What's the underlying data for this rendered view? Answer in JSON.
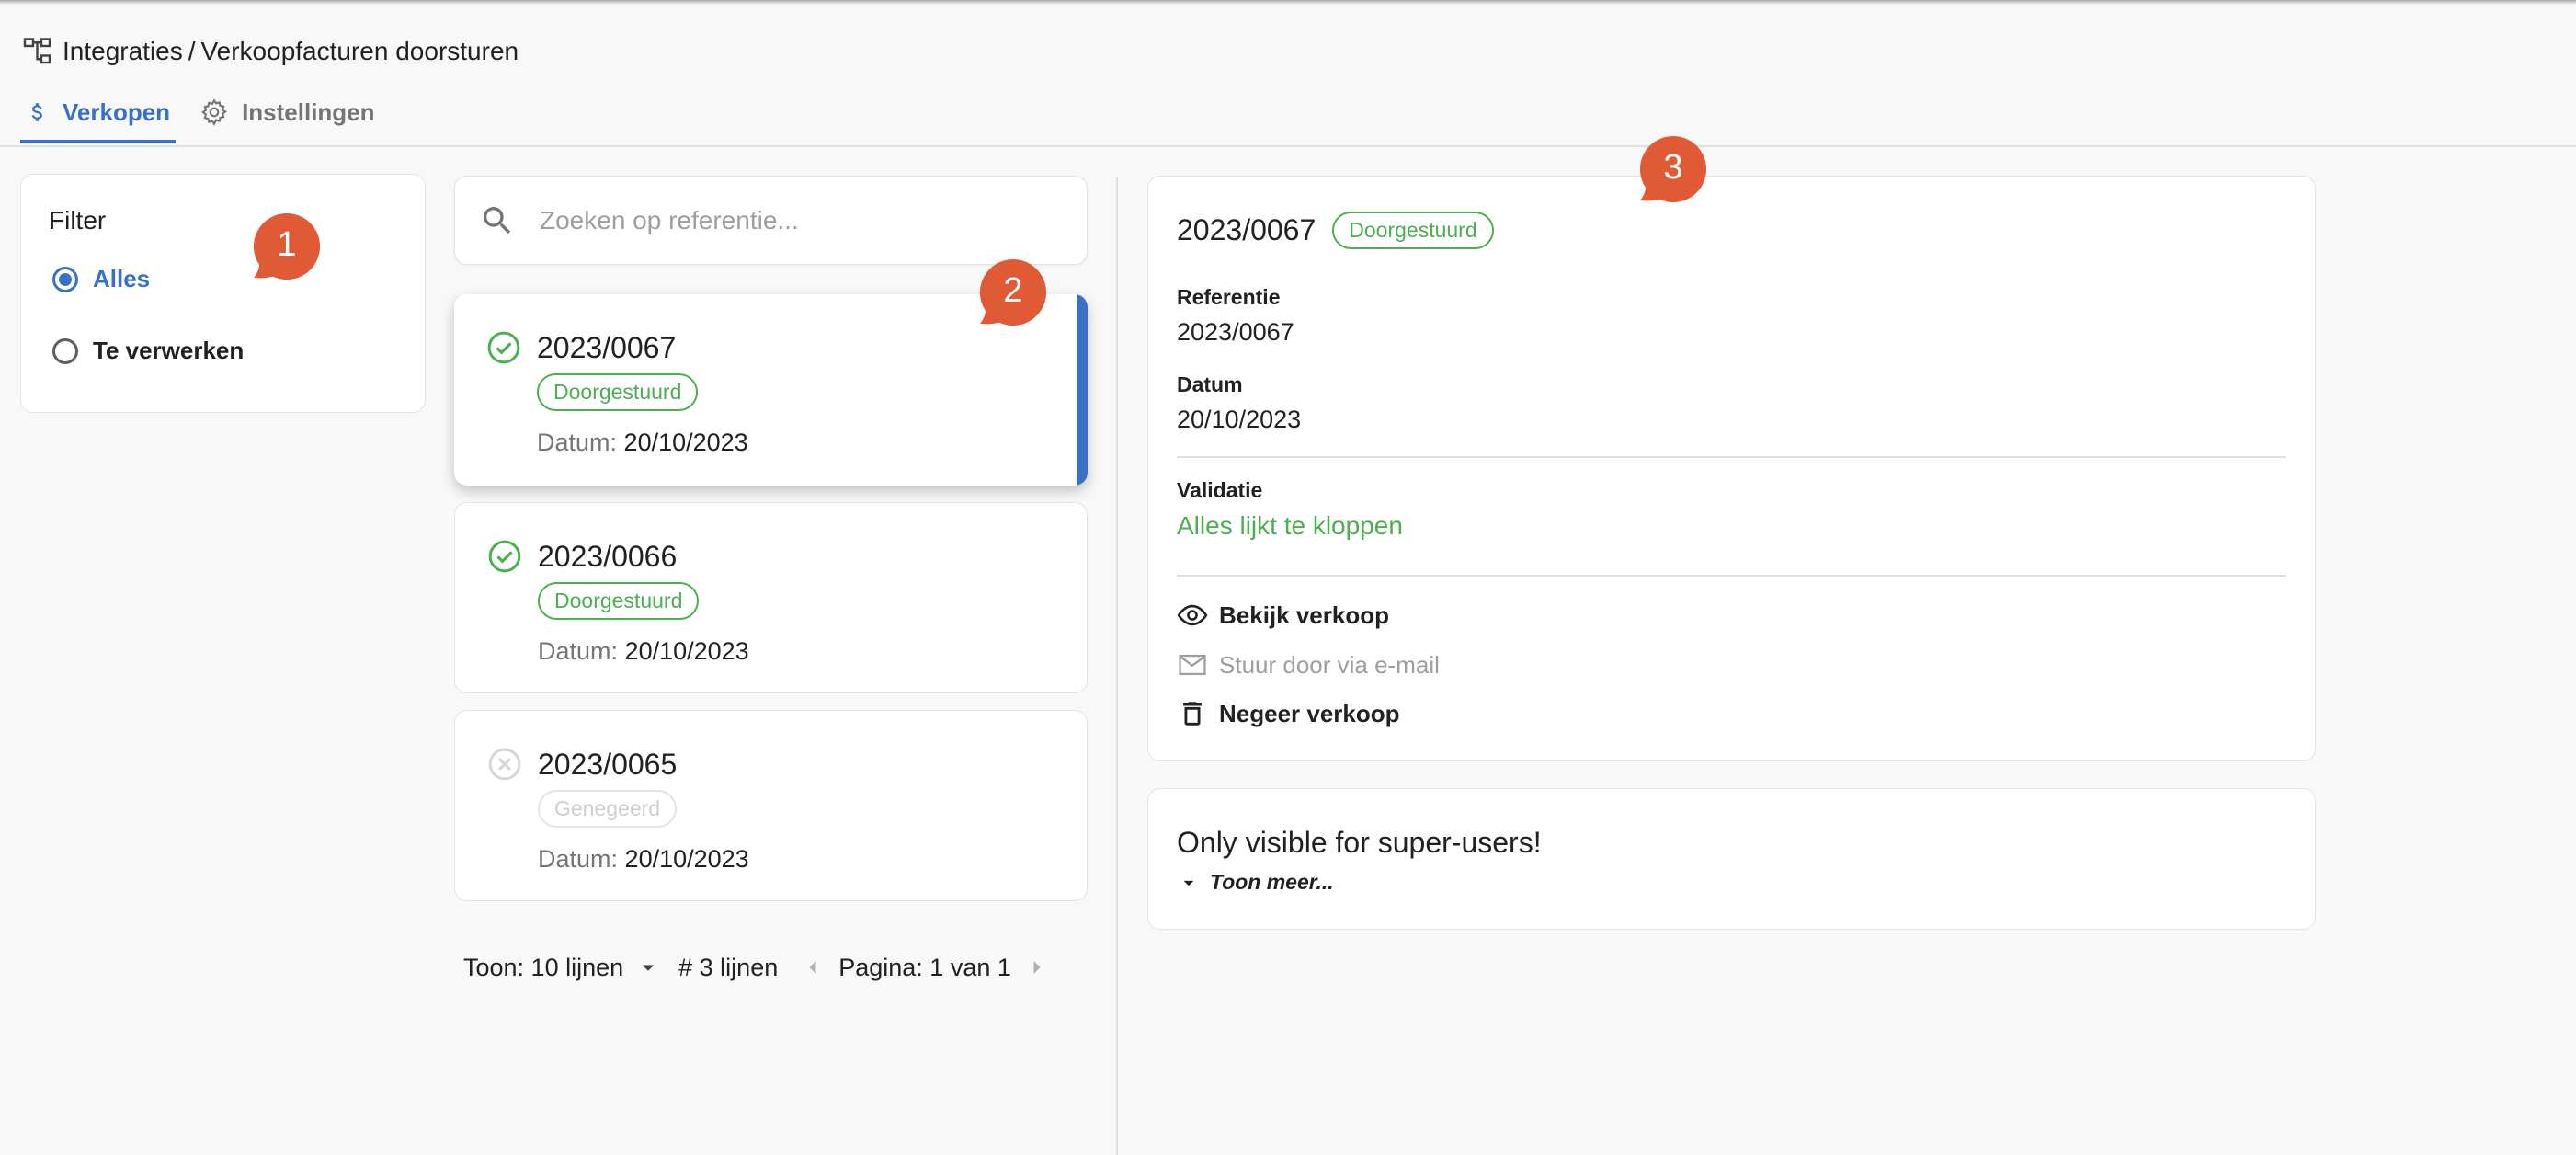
{
  "breadcrumb": {
    "section": "Integraties",
    "separator": "/",
    "page": "Verkoopfacturen doorsturen"
  },
  "tabs": [
    {
      "label": "Verkopen",
      "icon": "dollar-icon",
      "active": true
    },
    {
      "label": "Instellingen",
      "icon": "gear-icon",
      "active": false
    }
  ],
  "filter": {
    "title": "Filter",
    "options": [
      {
        "label": "Alles",
        "selected": true
      },
      {
        "label": "Te verwerken",
        "selected": false
      }
    ]
  },
  "search": {
    "placeholder": "Zoeken op referentie...",
    "value": ""
  },
  "items": [
    {
      "number": "2023/0067",
      "status": "Doorgestuurd",
      "status_icon": "check-circle-icon",
      "date_label": "Datum:",
      "date": "20/10/2023",
      "selected": true
    },
    {
      "number": "2023/0066",
      "status": "Doorgestuurd",
      "status_icon": "check-circle-icon",
      "date_label": "Datum:",
      "date": "20/10/2023",
      "selected": false
    },
    {
      "number": "2023/0065",
      "status": "Genegeerd",
      "status_icon": "cancel-circle-icon",
      "date_label": "Datum:",
      "date": "20/10/2023",
      "selected": false
    }
  ],
  "pager": {
    "show_label": "Toon: 10 lijnen",
    "count_label": "# 3 lijnen",
    "page_label": "Pagina: 1 van 1"
  },
  "detail": {
    "title": "2023/0067",
    "status": "Doorgestuurd",
    "reference_label": "Referentie",
    "reference_value": "2023/0067",
    "date_label": "Datum",
    "date_value": "20/10/2023",
    "validation_label": "Validatie",
    "validation_value": "Alles lijkt te kloppen",
    "actions": [
      {
        "label": "Bekijk verkoop",
        "icon": "eye-icon",
        "enabled": true
      },
      {
        "label": "Stuur door via e-mail",
        "icon": "mail-icon",
        "enabled": false
      },
      {
        "label": "Negeer verkoop",
        "icon": "trash-icon",
        "enabled": true
      }
    ]
  },
  "super_users": {
    "title": "Only visible for super-users!",
    "more_label": "Toon meer..."
  },
  "markers": [
    "1",
    "2",
    "3"
  ],
  "colors": {
    "accent": "#3a71c8",
    "success": "#4caf50",
    "marker": "#e05a35",
    "muted": "#757575"
  }
}
